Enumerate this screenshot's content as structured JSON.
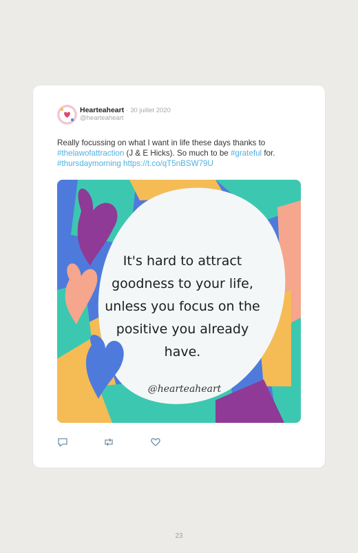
{
  "tweet": {
    "author_name": "Hearteaheart",
    "separator": "·",
    "date": "30 juillet 2020",
    "handle": "@hearteaheart",
    "text": {
      "part1": "Really focussing on what I want in life these days thanks to ",
      "hashtag1": "#thelawofattraction",
      "part2": " (J & E Hicks). So much to be ",
      "hashtag2": "#grateful",
      "part3": " for. ",
      "hashtag3": "#thursdaymorning",
      "space": " ",
      "url": "https://t.co/qT5nBSW79U"
    },
    "image": {
      "quote_lines": [
        "It's hard to attract",
        "goodness to your life,",
        "unless you focus on the",
        "positive you already",
        "have."
      ],
      "signature": "@hearteaheart",
      "colors": {
        "blue": "#4e7bdb",
        "teal": "#3cc8b0",
        "yellow": "#f5bb55",
        "purple": "#8e3a96",
        "salmon": "#f5a68c",
        "circle": "#f3f7f7"
      }
    },
    "actions": {
      "reply_icon": "reply-icon",
      "retweet_icon": "retweet-icon",
      "like_icon": "heart-icon"
    }
  },
  "page_number": "23"
}
